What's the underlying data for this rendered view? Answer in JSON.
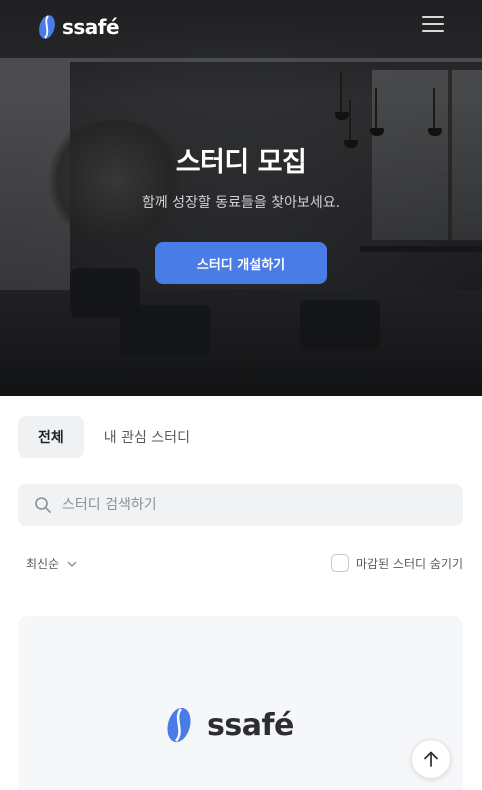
{
  "header": {
    "logo_text": "ssafé",
    "menu_icon": "hamburger-icon"
  },
  "hero": {
    "title": "스터디 모집",
    "subtitle": "함께 성장할 동료들을 찾아보세요.",
    "cta_label": "스터디 개설하기"
  },
  "tabs": [
    {
      "label": "전체",
      "active": true
    },
    {
      "label": "내 관심 스터디",
      "active": false
    }
  ],
  "search": {
    "placeholder": "스터디 검색하기",
    "value": "",
    "icon": "search-icon"
  },
  "filters": {
    "sort_label": "최신순",
    "hide_closed_label": "마감된 스터디 숨기기",
    "hide_closed_checked": false
  },
  "card": {
    "logo_text": "ssafé"
  },
  "colors": {
    "accent": "#4a7ce8",
    "logo_blue": "#4a7ce8"
  },
  "scroll_top_icon": "arrow-up-icon"
}
